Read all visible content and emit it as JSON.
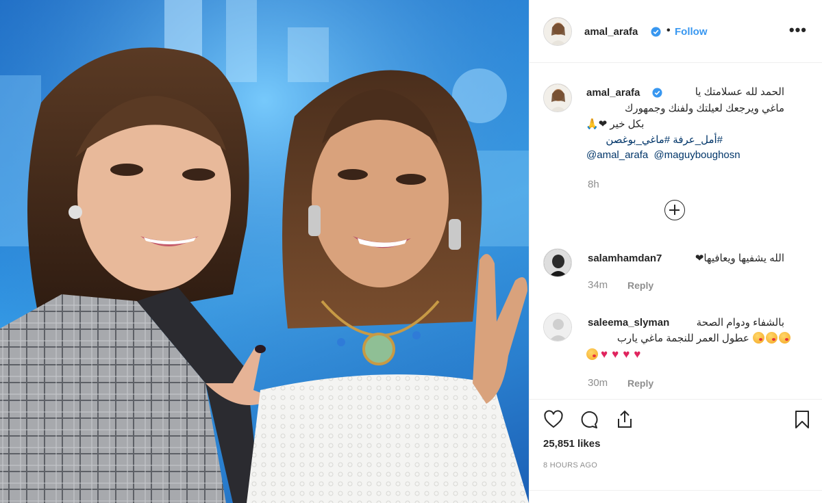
{
  "post": {
    "author": "amal_arafa",
    "follow_label": "Follow",
    "separator": "•",
    "more_label": "•••",
    "photo_alt": "Two women posing on a blue stage background, one making a victory sign"
  },
  "caption": {
    "user": "amal_arafa",
    "line1": "الحمد لله عسلامتك يا",
    "line2": "ماغي ويرجعك لعيلتك ولفنك وجمهورك",
    "line3_heart": "🙏❤",
    "line3_text": "بكل خير",
    "hashtags": "#أمل_عرفة #ماغي_بوغصن",
    "mention1": "@amal_arafa",
    "mention2": "@maguyboughosn",
    "time": "8h"
  },
  "comments": [
    {
      "user": "salamhamdan7",
      "text": "الله يشفيها ويعافيها❤",
      "time": "34m",
      "reply_label": "Reply"
    },
    {
      "user": "saleema_slyman",
      "text_line1": "بالشفاء ودوام الصحة",
      "text_line2": "عطول العمر للنجمة ماغي يارب",
      "time": "30m",
      "reply_label": "Reply"
    }
  ],
  "stats": {
    "likes": "25,851 likes",
    "posted_ago": "8 HOURS AGO"
  },
  "icons": {
    "like": "heart-outline-icon",
    "comment": "speech-bubble-icon",
    "share": "share-upload-icon",
    "save": "bookmark-icon",
    "verified": "verified-badge-icon",
    "load_more": "plus-circle-icon"
  },
  "colors": {
    "link": "#3897f0",
    "hashtag": "#003569",
    "muted": "#8e8e8e",
    "text": "#262626",
    "stage_blue": "#2d8fe0"
  }
}
